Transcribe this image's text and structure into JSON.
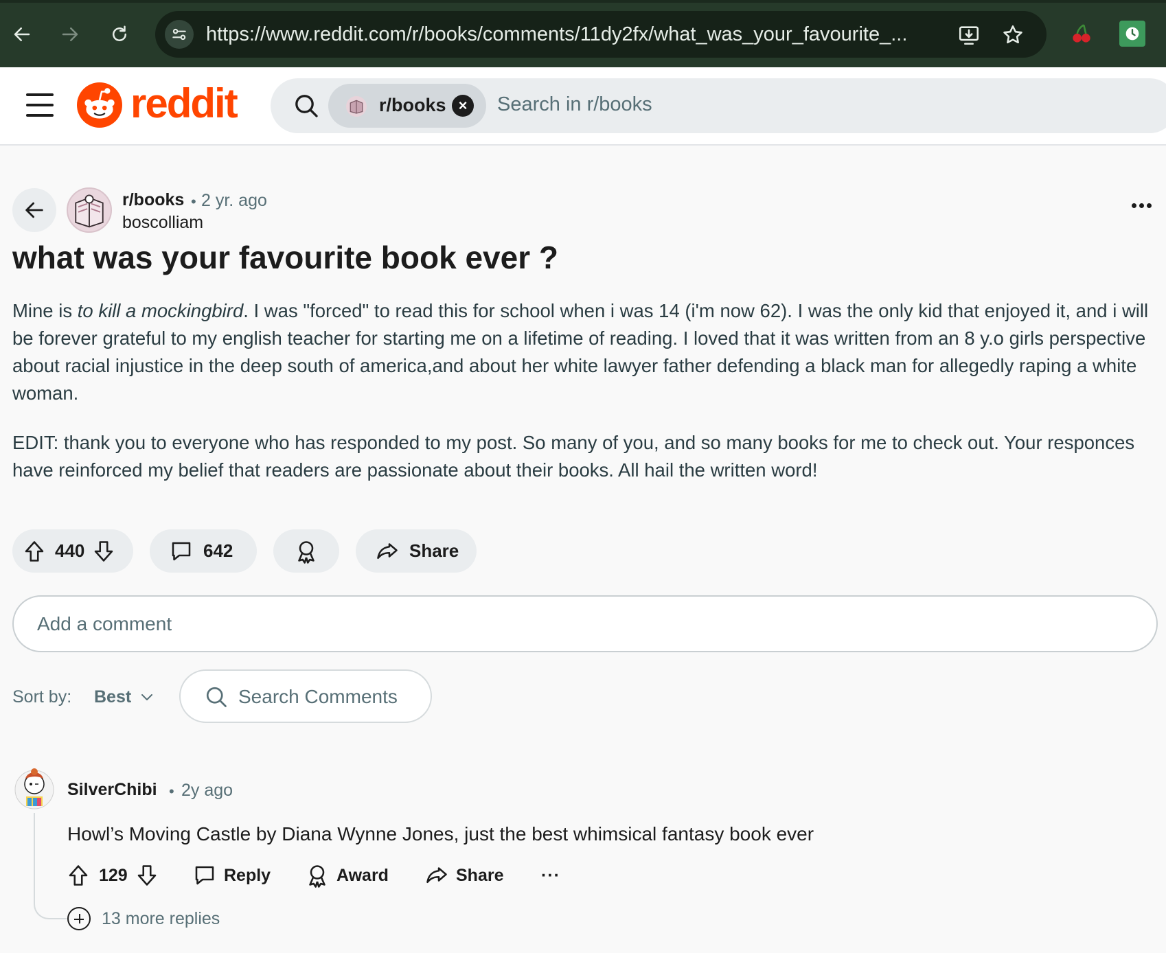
{
  "browser": {
    "url": "https://www.reddit.com/r/books/comments/11dy2fx/what_was_your_favourite_..."
  },
  "header": {
    "logo_text": "reddit",
    "search_chip": "r/books",
    "search_placeholder": "Search in r/books",
    "brand_color": "#ff4500"
  },
  "post": {
    "subreddit": "r/books",
    "separator": "•",
    "age": "2 yr. ago",
    "author": "boscolliam",
    "title": "what was your favourite book ever ?",
    "body_p1_prefix": "Mine is ",
    "body_p1_italic": "to kill a mockingbird",
    "body_p1_rest": ". I was \"forced\" to read this for school when i was 14 (i'm now 62). I was the only kid that enjoyed it, and i will be forever grateful to my english teacher for starting me on a lifetime of reading. I loved that it was written from an 8 y.o girls perspective about racial injustice in the deep south of america,and about her white lawyer father defending a black man for allegedly raping a white woman.",
    "body_p2": "EDIT: thank you to everyone who has responded to my post. So many of you, and so many books for me to check out. Your responces have reinforced my belief that readers are passionate about their books. All hail the written word!",
    "upvotes": "440",
    "comments": "642",
    "share_label": "Share"
  },
  "comment_box": {
    "placeholder": "Add a comment"
  },
  "sort": {
    "label": "Sort by:",
    "value": "Best",
    "search_placeholder": "Search Comments"
  },
  "comment": {
    "author": "SilverChibi",
    "separator": "•",
    "age": "2y ago",
    "body": "Howl’s Moving Castle by Diana Wynne Jones, just the best whimsical fantasy book ever",
    "upvotes": "129",
    "reply_label": "Reply",
    "award_label": "Award",
    "share_label": "Share",
    "more_replies": "13 more replies"
  }
}
